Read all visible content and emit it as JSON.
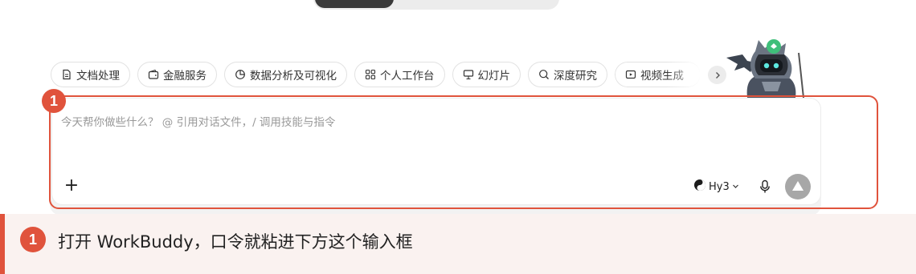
{
  "chips": [
    {
      "label": "文档处理",
      "icon": "document-icon"
    },
    {
      "label": "金融服务",
      "icon": "wallet-icon"
    },
    {
      "label": "数据分析及可视化",
      "icon": "pie-chart-icon"
    },
    {
      "label": "个人工作台",
      "icon": "grid-icon"
    },
    {
      "label": "幻灯片",
      "icon": "presentation-icon"
    },
    {
      "label": "深度研究",
      "icon": "research-icon"
    },
    {
      "label": "视频生成",
      "icon": "video-icon"
    }
  ],
  "input": {
    "placeholder": "今天帮你做些什么？ @ 引用对话文件，/ 调用技能与指令"
  },
  "toolbar": {
    "add_label": "+",
    "model_label": "Hy3"
  },
  "step": {
    "number": "1",
    "text": "打开 WorkBuddy，口令就粘进下方这个输入框"
  },
  "colors": {
    "accent": "#e0533c",
    "banner_bg": "#faf2f0",
    "send_button": "#a7a7a7"
  }
}
